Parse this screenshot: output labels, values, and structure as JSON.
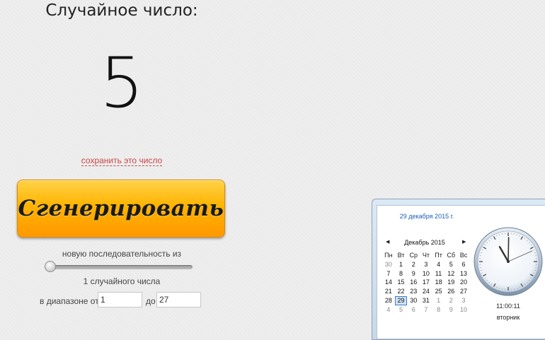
{
  "page": {
    "title": "Случайное число:",
    "number": "5",
    "save_link": "сохранить это число",
    "generate_button": "Сгенерировать",
    "sequence_label": "новую последовательность из",
    "count_label": "1 случайного числа",
    "range_from_label": "в диапазоне от",
    "range_from_value": "1",
    "range_to_label": "до",
    "range_to_value": "27",
    "slider_value": 1
  },
  "clock_widget": {
    "date_full": "29 декабря 2015 г.",
    "month_label": "Декабрь 2015",
    "prev_icon": "triangle-left-icon",
    "next_icon": "triangle-right-icon",
    "weekdays": [
      "Пн",
      "Вт",
      "Ср",
      "Чт",
      "Пт",
      "Сб",
      "Вс"
    ],
    "weeks": [
      [
        {
          "d": "30",
          "o": true
        },
        {
          "d": "1"
        },
        {
          "d": "2"
        },
        {
          "d": "3"
        },
        {
          "d": "4"
        },
        {
          "d": "5"
        },
        {
          "d": "6"
        }
      ],
      [
        {
          "d": "7"
        },
        {
          "d": "8"
        },
        {
          "d": "9"
        },
        {
          "d": "10"
        },
        {
          "d": "11"
        },
        {
          "d": "12"
        },
        {
          "d": "13"
        }
      ],
      [
        {
          "d": "14"
        },
        {
          "d": "15"
        },
        {
          "d": "16"
        },
        {
          "d": "17"
        },
        {
          "d": "18"
        },
        {
          "d": "19"
        },
        {
          "d": "20"
        }
      ],
      [
        {
          "d": "21"
        },
        {
          "d": "22"
        },
        {
          "d": "23"
        },
        {
          "d": "24"
        },
        {
          "d": "25"
        },
        {
          "d": "26"
        },
        {
          "d": "27"
        }
      ],
      [
        {
          "d": "28"
        },
        {
          "d": "29",
          "t": true
        },
        {
          "d": "30"
        },
        {
          "d": "31"
        },
        {
          "d": "1",
          "o": true
        },
        {
          "d": "2",
          "o": true
        },
        {
          "d": "3",
          "o": true
        }
      ],
      [
        {
          "d": "4",
          "o": true
        },
        {
          "d": "5",
          "o": true
        },
        {
          "d": "6",
          "o": true
        },
        {
          "d": "7",
          "o": true
        },
        {
          "d": "8",
          "o": true
        },
        {
          "d": "9",
          "o": true
        },
        {
          "d": "10",
          "o": true
        }
      ]
    ],
    "time": "11:00:11",
    "weekday_name": "вторник",
    "clock_hours": 11,
    "clock_minutes": 0,
    "clock_seconds": 11
  },
  "colors": {
    "accent_button": "#ffb400",
    "link": "#c94545",
    "date_link": "#1c5cb8"
  }
}
